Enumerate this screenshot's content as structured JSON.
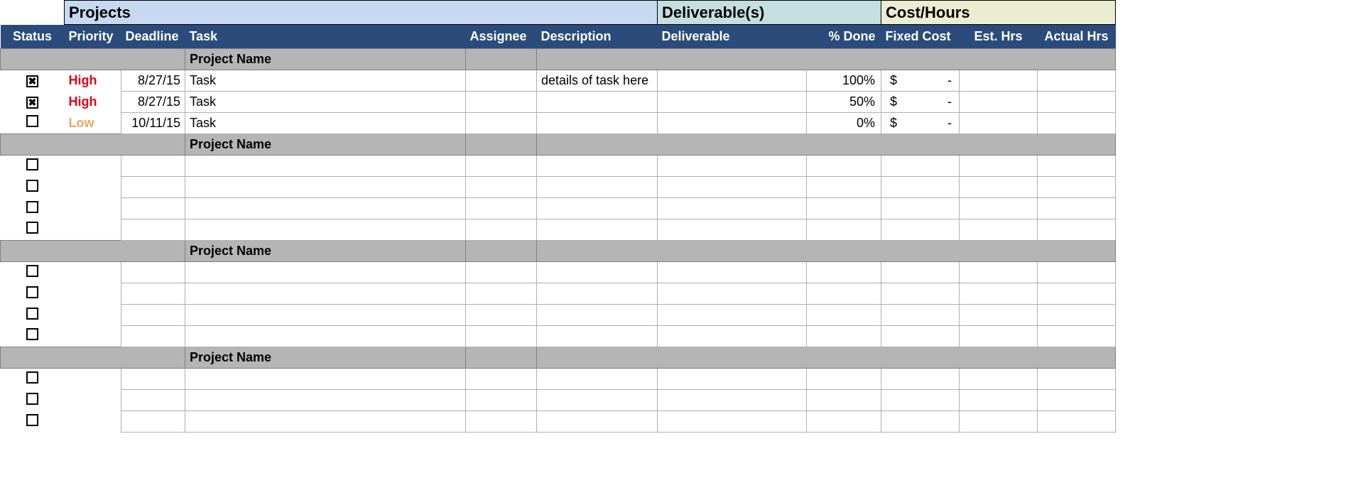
{
  "sections": {
    "projects": "Projects",
    "deliverables": "Deliverable(s)",
    "costhours": "Cost/Hours"
  },
  "headers": {
    "status": "Status",
    "priority": "Priority",
    "deadline": "Deadline",
    "task": "Task",
    "assignee": "Assignee",
    "description": "Description",
    "deliverable": "Deliverable",
    "pct_done": "% Done",
    "fixed_cost": "Fixed Cost",
    "est_hrs": "Est. Hrs",
    "actual_hrs": "Actual Hrs"
  },
  "project_label": "Project Name",
  "cost_currency": "$",
  "cost_dash": "-",
  "groups": [
    {
      "rows": [
        {
          "checked": true,
          "priority": "High",
          "priority_class": "high",
          "deadline": "8/27/15",
          "task": "Task",
          "assignee": "",
          "description": "details of task here",
          "deliverable": "",
          "pct_done": "100%",
          "cost": true,
          "est": "",
          "act": ""
        },
        {
          "checked": true,
          "priority": "High",
          "priority_class": "high",
          "deadline": "8/27/15",
          "task": "Task",
          "assignee": "",
          "description": "",
          "deliverable": "",
          "pct_done": "50%",
          "cost": true,
          "est": "",
          "act": ""
        },
        {
          "checked": false,
          "priority": "Low",
          "priority_class": "low",
          "deadline": "10/11/15",
          "task": "Task",
          "assignee": "",
          "description": "",
          "deliverable": "",
          "pct_done": "0%",
          "cost": true,
          "est": "",
          "act": ""
        }
      ]
    },
    {
      "rows": [
        {
          "checked": false,
          "priority": "",
          "priority_class": "",
          "deadline": "",
          "task": "",
          "assignee": "",
          "description": "",
          "deliverable": "",
          "pct_done": "",
          "cost": false,
          "est": "",
          "act": ""
        },
        {
          "checked": false,
          "priority": "",
          "priority_class": "",
          "deadline": "",
          "task": "",
          "assignee": "",
          "description": "",
          "deliverable": "",
          "pct_done": "",
          "cost": false,
          "est": "",
          "act": ""
        },
        {
          "checked": false,
          "priority": "",
          "priority_class": "",
          "deadline": "",
          "task": "",
          "assignee": "",
          "description": "",
          "deliverable": "",
          "pct_done": "",
          "cost": false,
          "est": "",
          "act": ""
        },
        {
          "checked": false,
          "priority": "",
          "priority_class": "",
          "deadline": "",
          "task": "",
          "assignee": "",
          "description": "",
          "deliverable": "",
          "pct_done": "",
          "cost": false,
          "est": "",
          "act": ""
        }
      ]
    },
    {
      "rows": [
        {
          "checked": false,
          "priority": "",
          "priority_class": "",
          "deadline": "",
          "task": "",
          "assignee": "",
          "description": "",
          "deliverable": "",
          "pct_done": "",
          "cost": false,
          "est": "",
          "act": ""
        },
        {
          "checked": false,
          "priority": "",
          "priority_class": "",
          "deadline": "",
          "task": "",
          "assignee": "",
          "description": "",
          "deliverable": "",
          "pct_done": "",
          "cost": false,
          "est": "",
          "act": ""
        },
        {
          "checked": false,
          "priority": "",
          "priority_class": "",
          "deadline": "",
          "task": "",
          "assignee": "",
          "description": "",
          "deliverable": "",
          "pct_done": "",
          "cost": false,
          "est": "",
          "act": ""
        },
        {
          "checked": false,
          "priority": "",
          "priority_class": "",
          "deadline": "",
          "task": "",
          "assignee": "",
          "description": "",
          "deliverable": "",
          "pct_done": "",
          "cost": false,
          "est": "",
          "act": ""
        }
      ]
    },
    {
      "rows": [
        {
          "checked": false,
          "priority": "",
          "priority_class": "",
          "deadline": "",
          "task": "",
          "assignee": "",
          "description": "",
          "deliverable": "",
          "pct_done": "",
          "cost": false,
          "est": "",
          "act": ""
        },
        {
          "checked": false,
          "priority": "",
          "priority_class": "",
          "deadline": "",
          "task": "",
          "assignee": "",
          "description": "",
          "deliverable": "",
          "pct_done": "",
          "cost": false,
          "est": "",
          "act": ""
        },
        {
          "checked": false,
          "priority": "",
          "priority_class": "",
          "deadline": "",
          "task": "",
          "assignee": "",
          "description": "",
          "deliverable": "",
          "pct_done": "",
          "cost": false,
          "est": "",
          "act": ""
        }
      ]
    }
  ]
}
